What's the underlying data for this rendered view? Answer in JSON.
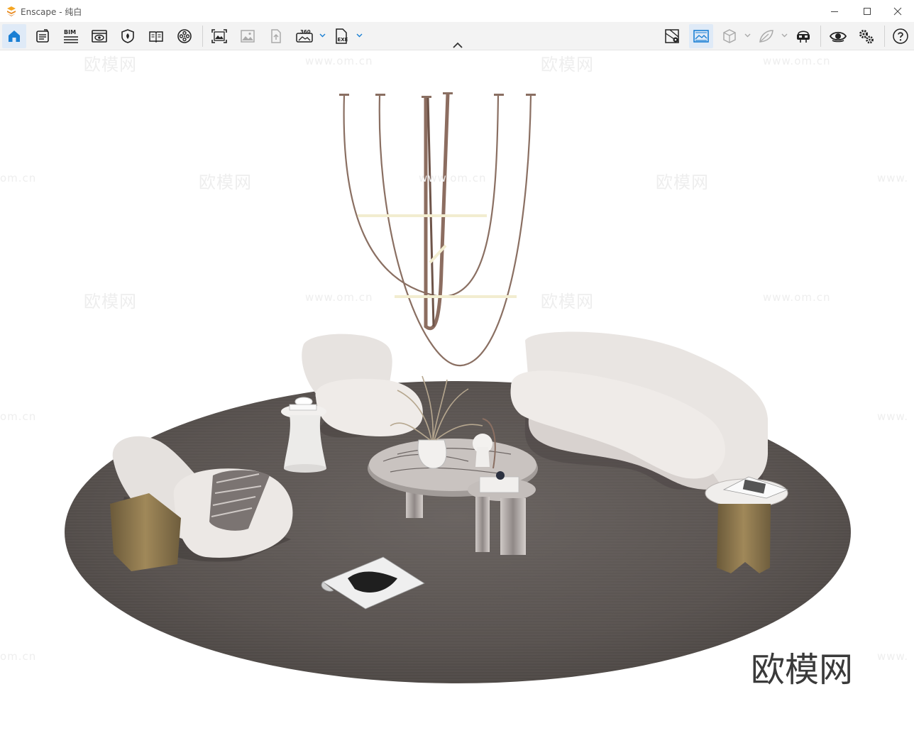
{
  "window": {
    "app_name": "Enscape",
    "separator": " - ",
    "document_name": "纯白"
  },
  "toolbar": {
    "bim_label": "BIM",
    "pano_label": "360",
    "exe_label": "EXE"
  },
  "watermarks": {
    "brand": "欧模网",
    "url": "www.om.cn",
    "domain_fragment": "om.cn",
    "www_fragment": "www."
  },
  "colors": {
    "accent": "#1a7fd4",
    "logo": "#f5a623",
    "rug": "#5b5552",
    "upholstery": "#e9e5e2"
  }
}
